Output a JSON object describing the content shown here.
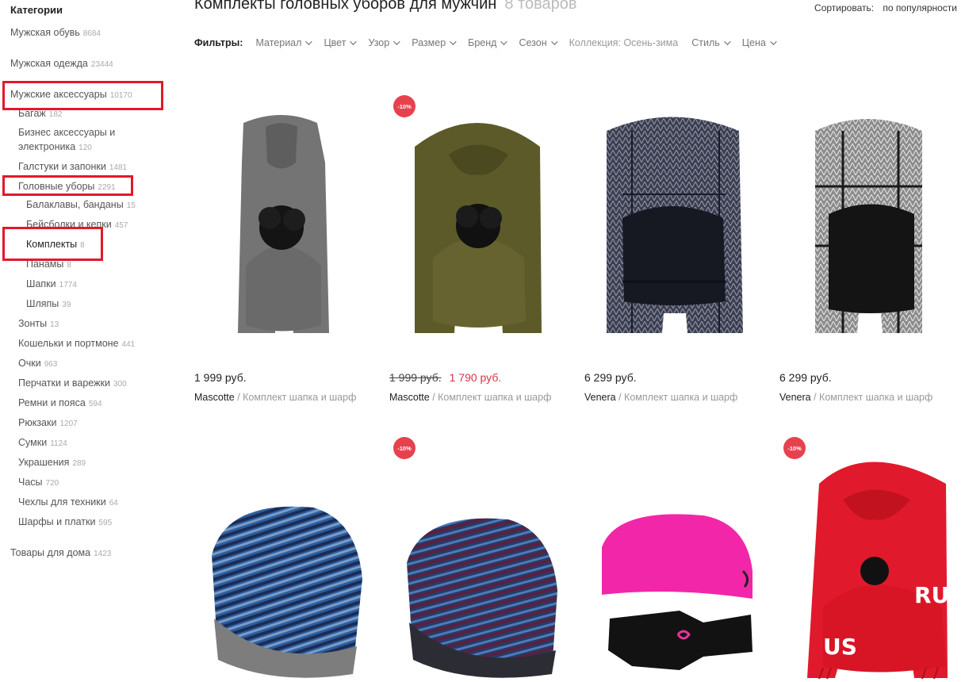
{
  "sidebar": {
    "title": "Категории",
    "items": [
      {
        "label": "Мужская обувь",
        "count": "8684"
      },
      {
        "label": "Мужская одежда",
        "count": "23444"
      },
      {
        "label": "Мужские аксессуары",
        "count": "10170"
      },
      {
        "label": "Багаж",
        "count": "182"
      },
      {
        "label": "Бизнес аксессуары и электроника",
        "count": "120"
      },
      {
        "label": "Галстуки и запонки",
        "count": "1481"
      },
      {
        "label": "Головные уборы",
        "count": "2291"
      },
      {
        "label": "Балаклавы, банданы",
        "count": "15"
      },
      {
        "label": "Бейсболки и кепки",
        "count": "457"
      },
      {
        "label": "Комплекты",
        "count": "8"
      },
      {
        "label": "Панамы",
        "count": "8"
      },
      {
        "label": "Шапки",
        "count": "1774"
      },
      {
        "label": "Шляпы",
        "count": "39"
      },
      {
        "label": "Зонты",
        "count": "13"
      },
      {
        "label": "Кошельки и портмоне",
        "count": "441"
      },
      {
        "label": "Очки",
        "count": "963"
      },
      {
        "label": "Перчатки и варежки",
        "count": "300"
      },
      {
        "label": "Ремни и пояса",
        "count": "594"
      },
      {
        "label": "Рюкзаки",
        "count": "1207"
      },
      {
        "label": "Сумки",
        "count": "1124"
      },
      {
        "label": "Украшения",
        "count": "289"
      },
      {
        "label": "Часы",
        "count": "720"
      },
      {
        "label": "Чехлы для техники",
        "count": "64"
      },
      {
        "label": "Шарфы и платки",
        "count": "595"
      },
      {
        "label": "Товары для дома",
        "count": "1423"
      }
    ]
  },
  "header": {
    "title": "Комплекты головных уборов для мужчин",
    "count": "8 товаров",
    "sort_label": "Сортировать:",
    "sort_value": "по популярности"
  },
  "filters": {
    "label": "Фильтры:",
    "items": [
      "Материал",
      "Цвет",
      "Узор",
      "Размер",
      "Бренд",
      "Сезон"
    ],
    "collection": "Коллекция: Осень-зима",
    "items2": [
      "Стиль",
      "Цена"
    ]
  },
  "products": [
    {
      "price": "1 999 руб.",
      "brand": "Mascotte",
      "desc": " / Комплект шапка и шарф",
      "image": "grey-scarf-hat-pompom"
    },
    {
      "badge": "-10%",
      "old_price": "1 999 руб.",
      "new_price": "1 790 руб.",
      "brand": "Mascotte",
      "desc": " / Комплект шапка и шарф",
      "image": "olive-scarf-hat-pompom"
    },
    {
      "price": "6 299 руб.",
      "brand": "Venera",
      "desc": " / Комплект шапка и шарф",
      "image": "navy-herringbone-scarf-hat"
    },
    {
      "price": "6 299 руб.",
      "brand": "Venera",
      "desc": " / Комплект шапка и шарф",
      "image": "grey-check-scarf-hat"
    },
    {
      "image": "blue-striped-beanie"
    },
    {
      "badge": "-10%",
      "image": "dark-striped-beanie"
    },
    {
      "image": "pink-beanie-black-gloves"
    },
    {
      "badge": "-10%",
      "image": "red-scarf-hat-rus"
    }
  ],
  "colors": {
    "highlight": "#e01a2a",
    "badge": "#e6424e",
    "sale_price": "#d4354a"
  }
}
